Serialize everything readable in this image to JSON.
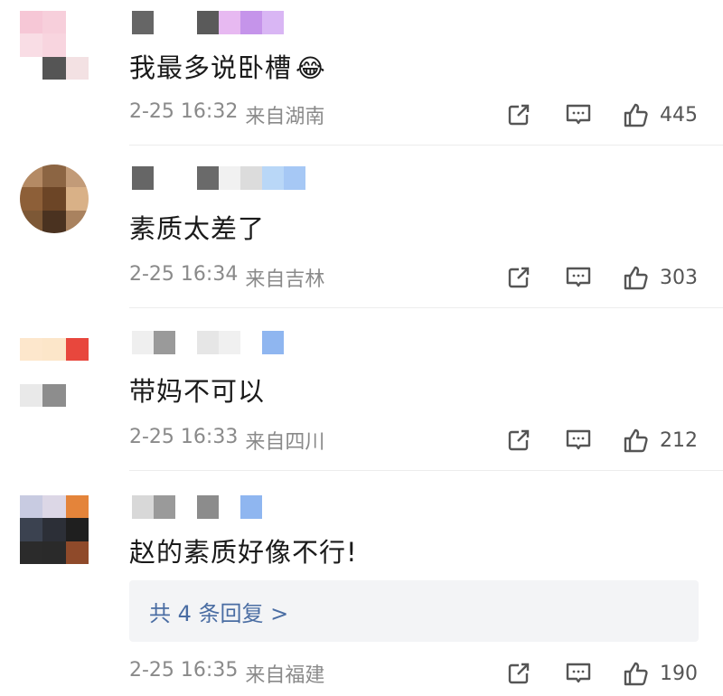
{
  "comments": [
    {
      "text": "我最多说卧槽",
      "emoji": "😂",
      "time": "2-25 16:32",
      "location": "来自湖南",
      "likes": "445",
      "avatar_colors": [
        "#f6c7d6",
        "#f7cfdb",
        "#ffffff",
        "#f9dde5",
        "#f8d5df",
        "#ffffff",
        "#ffffff",
        "#555555",
        "#f3e1e3"
      ],
      "name_colors": [
        "#666666",
        "#ffffff",
        "#ffffff",
        "#5a5a5a",
        "#e7b9f1",
        "#c594ea",
        "#d9b6f4"
      ]
    },
    {
      "text": "素质太差了",
      "time": "2-25 16:34",
      "location": "来自吉林",
      "likes": "303",
      "avatar_colors": [
        "#b48a64",
        "#8c6543",
        "#c29b78",
        "#8d5f38",
        "#6c4526",
        "#d9b187",
        "#7d5836",
        "#4a3220",
        "#a9825f"
      ],
      "name_colors": [
        "#666666",
        "#ffffff",
        "#ffffff",
        "#6a6a6a",
        "#f1f1f1",
        "#dcdcdc",
        "#b9d7f7",
        "#a6c8f5"
      ]
    },
    {
      "text": "带妈不可以",
      "time": "2-25 16:33",
      "location": "来自四川",
      "likes": "212",
      "avatar_colors": [
        "#fde7cc",
        "#fce6c9",
        "#e8473d",
        "#ffffff",
        "#ffffff",
        "#ffffff",
        "#e9e9e9",
        "#8d8d8d",
        "#ffffff"
      ],
      "name_colors": [
        "#efefef",
        "#9a9a9a",
        "#ffffff",
        "#e6e6e6",
        "#f0f0f0",
        "#ffffff",
        "#8fb6f0"
      ]
    },
    {
      "text": "赵的素质好像不行!",
      "time": "2-25 16:35",
      "location": "来自福建",
      "likes": "190",
      "reply_label": "共 4 条回复 >",
      "avatar_colors": [
        "#c8cbe1",
        "#dcd7e6",
        "#e4843a",
        "#3b4250",
        "#2c2f37",
        "#1f1f1f",
        "#2b2b2b",
        "#2a2a2a",
        "#8f4a2a"
      ],
      "name_colors": [
        "#d8d8d8",
        "#9a9a9a",
        "#ffffff",
        "#8c8c8c",
        "#ffffff",
        "#8fb6f0"
      ]
    }
  ],
  "icons": {
    "share": "share-icon",
    "comment": "comment-icon",
    "like": "like-icon"
  }
}
